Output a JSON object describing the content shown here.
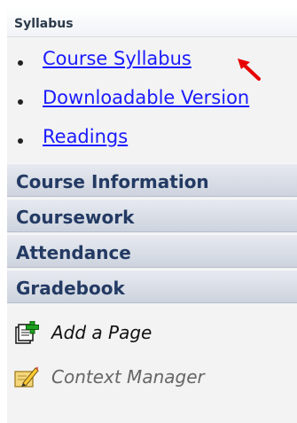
{
  "section": {
    "title": "Syllabus"
  },
  "syllabus_links": [
    {
      "label": "Course Syllabus"
    },
    {
      "label": "Downloadable Version"
    },
    {
      "label": "Readings"
    }
  ],
  "nav": [
    {
      "label": "Course Information"
    },
    {
      "label": "Coursework"
    },
    {
      "label": "Attendance"
    },
    {
      "label": "Gradebook"
    }
  ],
  "tools": {
    "add_page": {
      "label": "Add a Page",
      "icon": "add-page-icon"
    },
    "context_manager": {
      "label": "Context Manager",
      "icon": "context-manager-icon"
    }
  },
  "colors": {
    "link": "#1a1aff",
    "nav_text": "#233a63",
    "arrow": "#e60000"
  }
}
